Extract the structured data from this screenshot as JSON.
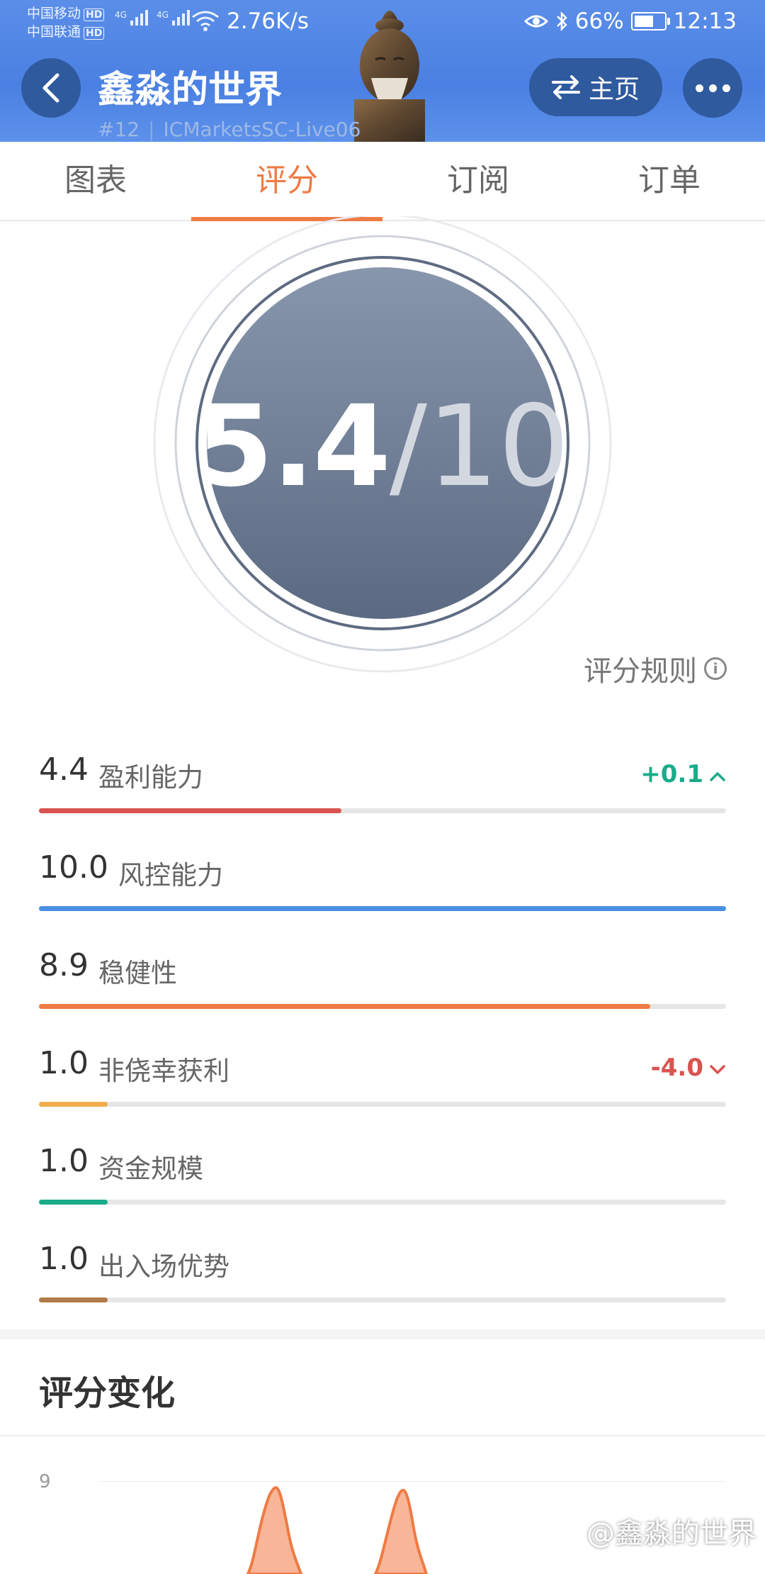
{
  "status_bar": {
    "carrier1": "中国移动",
    "carrier2": "中国联通",
    "hd": "HD",
    "network": "4G",
    "speed": "2.76K/s",
    "battery": "66%",
    "time": "12:13"
  },
  "header": {
    "title": "鑫淼的世界",
    "rank": "#12",
    "server": "ICMarketsSC-Live06",
    "home_label": "主页",
    "colors": {
      "bg": "#4a80e2",
      "button": "#2f5a9e"
    }
  },
  "tabs": [
    {
      "label": "图表",
      "active": false
    },
    {
      "label": "评分",
      "active": true
    },
    {
      "label": "订阅",
      "active": false
    },
    {
      "label": "订单",
      "active": false
    }
  ],
  "score": {
    "value": "5.4",
    "rest": "/10",
    "fraction": 0.54
  },
  "rules_label": "评分规则",
  "metrics": [
    {
      "value": "4.4",
      "label": "盈利能力",
      "change": "+0.1",
      "direction": "up",
      "fill": 0.44,
      "color": "#d9534f"
    },
    {
      "value": "10.0",
      "label": "风控能力",
      "change": "",
      "direction": "",
      "fill": 1.0,
      "color": "#4a90e2"
    },
    {
      "value": "8.9",
      "label": "稳健性",
      "change": "",
      "direction": "",
      "fill": 0.89,
      "color": "#ee7b45"
    },
    {
      "value": "1.0",
      "label": "非侥幸获利",
      "change": "-4.0",
      "direction": "down",
      "fill": 0.1,
      "color": "#f0ad4e"
    },
    {
      "value": "1.0",
      "label": "资金规模",
      "change": "",
      "direction": "",
      "fill": 0.1,
      "color": "#1aab8a"
    },
    {
      "value": "1.0",
      "label": "出入场优势",
      "change": "",
      "direction": "",
      "fill": 0.1,
      "color": "#b07a4a"
    }
  ],
  "change_colors": {
    "up": "#1aab8a",
    "down": "#d9534f"
  },
  "section_title": "评分变化",
  "chart": {
    "y_tick": "9"
  },
  "watermark": "@鑫淼的世界"
}
